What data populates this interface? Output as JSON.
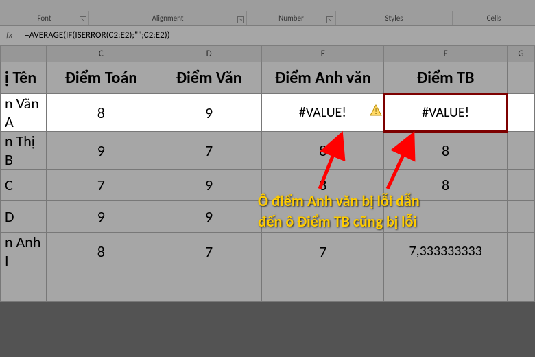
{
  "ribbon": {
    "groups": [
      "Font",
      "Alignment",
      "Number",
      "Styles",
      "Cells"
    ]
  },
  "formula_bar": {
    "fx": "fx",
    "formula": "=AVERAGE(IF(ISERROR(C2:E2);\"\";C2:E2))"
  },
  "columns": [
    "C",
    "D",
    "E",
    "F",
    "G"
  ],
  "headers": {
    "partial": "ị Tên",
    "c": "Điểm Toán",
    "d": "Điểm Văn",
    "e": "Điểm Anh văn",
    "f": "Điểm TB"
  },
  "rows": [
    {
      "partial": "n Văn A",
      "c": "8",
      "d": "9",
      "e": "#VALUE!",
      "f": "#VALUE!"
    },
    {
      "partial": "n Thị B",
      "c": "9",
      "d": "7",
      "e": "8",
      "f": "8"
    },
    {
      "partial": "C",
      "c": "7",
      "d": "9",
      "e": "8",
      "f": "8"
    },
    {
      "partial": "D",
      "c": "9",
      "d": "9",
      "e": "",
      "f": ""
    },
    {
      "partial": "n Anh I",
      "c": "8",
      "d": "7",
      "e": "7",
      "f": "7,333333333"
    }
  ],
  "annotation": {
    "line1": "Ô điểm Anh văn bị lỗi dẫn",
    "line2": "đến ô Điểm TB cũng bị lỗi"
  },
  "colors": {
    "active_border": "#c00000",
    "annotation_text": "#ffcc00",
    "arrow": "#ff0000"
  }
}
